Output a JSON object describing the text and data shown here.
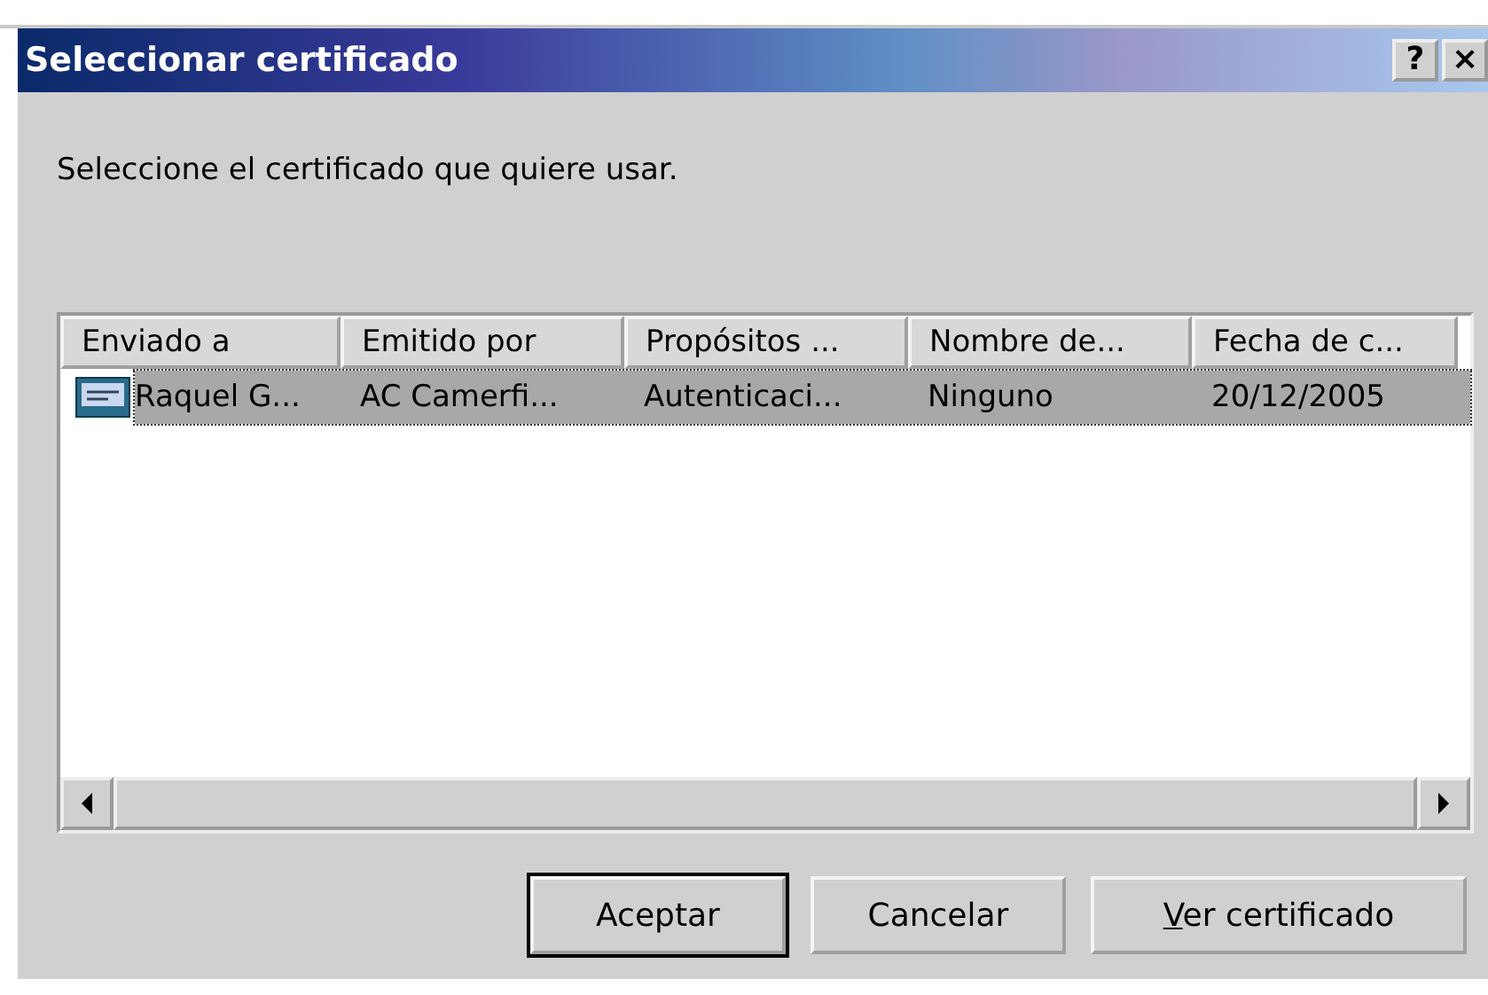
{
  "window": {
    "title": "Seleccionar certificado",
    "title_buttons": [
      "?",
      "×"
    ]
  },
  "prompt": "Seleccione el certificado que quiere usar.",
  "table": {
    "columns": [
      "Enviado a",
      "Emitido por",
      "Propósitos ...",
      "Nombre de...",
      "Fecha de c..."
    ],
    "rows": [
      {
        "cells": [
          "Raquel G...",
          "AC Camerfi...",
          "Autenticaci...",
          "Ninguno",
          "20/12/2005"
        ],
        "selected": true
      }
    ]
  },
  "buttons": [
    {
      "label": "Aceptar",
      "default": true,
      "mnemonic": false
    },
    {
      "label": "Cancelar",
      "default": false,
      "mnemonic": false
    },
    {
      "label": "Ver certificado",
      "default": false,
      "mnemonic": true
    }
  ]
}
